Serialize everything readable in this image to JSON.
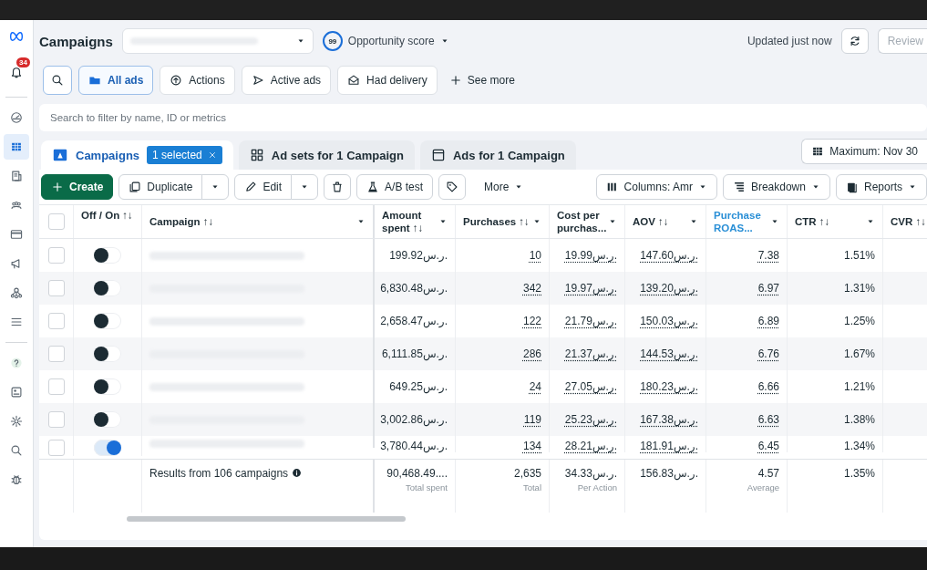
{
  "sidebar": {
    "badge": "34",
    "items": [
      {
        "kind": "gauge",
        "selected": false
      },
      {
        "kind": "table",
        "selected": true
      },
      {
        "kind": "document",
        "selected": false
      },
      {
        "kind": "people",
        "selected": false
      },
      {
        "kind": "card",
        "selected": false
      },
      {
        "kind": "megaphone",
        "selected": false
      },
      {
        "kind": "network",
        "selected": false
      },
      {
        "kind": "menu",
        "selected": false
      },
      {
        "kind": "help",
        "selected": false
      },
      {
        "kind": "contact",
        "selected": false
      },
      {
        "kind": "settings",
        "selected": false
      },
      {
        "kind": "search",
        "selected": false
      },
      {
        "kind": "bug",
        "selected": false
      }
    ]
  },
  "header": {
    "title": "Campaigns",
    "opportunity": {
      "score": "99",
      "label": "Opportunity score"
    },
    "updated": "Updated just now",
    "review_button": "Review"
  },
  "filters": [
    {
      "label": "All ads",
      "selected": true
    },
    {
      "label": "Actions",
      "selected": false
    },
    {
      "label": "Active ads",
      "selected": false
    },
    {
      "label": "Had delivery",
      "selected": false
    }
  ],
  "see_more": "See more",
  "search": {
    "placeholder": "Search to filter by name, ID or metrics"
  },
  "level_tabs": [
    {
      "label": "Campaigns",
      "selected": true,
      "badge": "1 selected"
    },
    {
      "label": "Ad sets for 1 Campaign",
      "selected": false
    },
    {
      "label": "Ads for 1 Campaign",
      "selected": false
    }
  ],
  "date_button": "Maximum: Nov 30",
  "toolbar": [
    {
      "kind": "create",
      "label": "Create"
    },
    {
      "kind": "split",
      "label": "Duplicate"
    },
    {
      "kind": "split",
      "label": "Edit"
    },
    {
      "kind": "icon"
    },
    {
      "kind": "button",
      "label": "A/B test"
    },
    {
      "kind": "icon"
    },
    {
      "kind": "menu",
      "label": "More"
    },
    {
      "kind": "dropdown",
      "label": "Columns: Amr"
    },
    {
      "kind": "dropdown",
      "label": "Breakdown"
    },
    {
      "kind": "dropdown",
      "label": "Reports"
    }
  ],
  "table": {
    "select_all_checked": false,
    "toggle_header": "Off / On ↑↓",
    "name_header": "Campaign ↑↓",
    "columns": [
      {
        "label": "Amount spent ↑↓",
        "highlighted": false
      },
      {
        "label": "Purchases ↑↓",
        "highlighted": false
      },
      {
        "label": "Cost per purchas...",
        "highlighted": false
      },
      {
        "label": "AOV ↑↓",
        "highlighted": false
      },
      {
        "label": "Purchase ROAS...",
        "highlighted": true
      },
      {
        "label": "CTR ↑↓",
        "highlighted": false
      },
      {
        "label": "CVR ↑↓",
        "highlighted": false
      }
    ],
    "rows": [
      {
        "checked": false,
        "on": false,
        "cells": [
          "199.92ر.س.",
          "10",
          "19.99ر.س.",
          "147.60ر.س.",
          "7.38",
          "1.51%"
        ]
      },
      {
        "checked": false,
        "on": false,
        "cells": [
          "6,830.48ر.س.",
          "342",
          "19.97ر.س.",
          "139.20ر.س.",
          "6.97",
          "1.31%"
        ]
      },
      {
        "checked": false,
        "on": false,
        "cells": [
          "2,658.47ر.س.",
          "122",
          "21.79ر.س.",
          "150.03ر.س.",
          "6.89",
          "1.25%"
        ]
      },
      {
        "checked": false,
        "on": false,
        "cells": [
          "6,111.85ر.س.",
          "286",
          "21.37ر.س.",
          "144.53ر.س.",
          "6.76",
          "1.67%"
        ]
      },
      {
        "checked": false,
        "on": false,
        "cells": [
          "649.25ر.س.",
          "24",
          "27.05ر.س.",
          "180.23ر.س.",
          "6.66",
          "1.21%"
        ]
      },
      {
        "checked": false,
        "on": false,
        "cells": [
          "3,002.86ر.س.",
          "119",
          "25.23ر.س.",
          "167.38ر.س.",
          "6.63",
          "1.38%"
        ]
      },
      {
        "checked": false,
        "on": true,
        "cells": [
          "3,780.44ر.س.",
          "134",
          "28.21ر.س.",
          "181.91ر.س.",
          "6.45",
          "1.34%"
        ]
      }
    ],
    "totals": {
      "label": "Results from 106 campaigns",
      "cells": [
        {
          "value": "90,468.49....",
          "note": "Total spent"
        },
        {
          "value": "2,635",
          "note": "Total"
        },
        {
          "value": "34.33ر.س.",
          "note": "Per Action"
        },
        {
          "value": "156.83ر.س."
        },
        {
          "value": "4.57",
          "note": "Average"
        },
        {
          "value": "1.35%"
        }
      ]
    }
  }
}
